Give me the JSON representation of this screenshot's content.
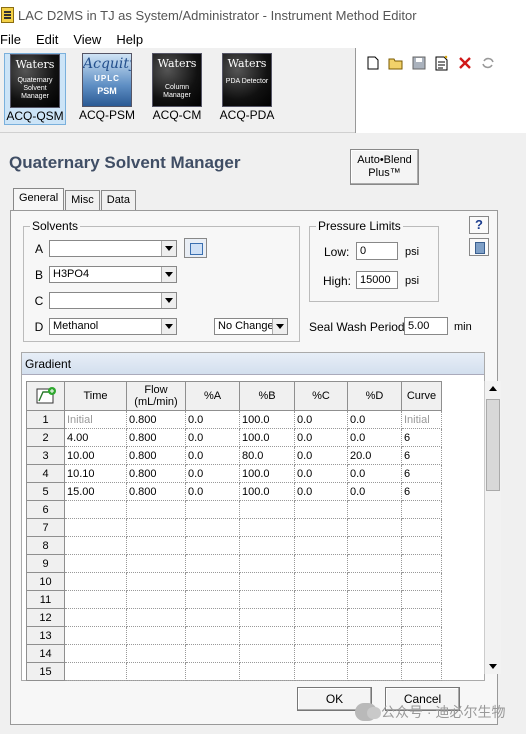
{
  "window": {
    "title": "LAC D2MS in TJ as System/Administrator - Instrument Method Editor"
  },
  "menu": {
    "items": [
      "File",
      "Edit",
      "View",
      "Help"
    ]
  },
  "modules": [
    {
      "label": "ACQ-QSM",
      "brand": "Waters",
      "sub": "Quaternary Solvent Manager",
      "selected": true
    },
    {
      "label": "ACQ-PSM",
      "brand": "Acquity",
      "sub": "UPLC",
      "extra": "PSM",
      "selected": false
    },
    {
      "label": "ACQ-CM",
      "brand": "Waters",
      "sub": "Column Manager",
      "selected": false
    },
    {
      "label": "ACQ-PDA",
      "brand": "Waters",
      "sub": "PDA Detector",
      "selected": false
    }
  ],
  "panel": {
    "title": "Quaternary Solvent Manager",
    "autoblend_label": "Auto•Blend Plus™"
  },
  "tabs": [
    "General",
    "Misc",
    "Data"
  ],
  "solvents": {
    "legend": "Solvents",
    "rows": [
      {
        "letter": "A",
        "value": ""
      },
      {
        "letter": "B",
        "value": "H3PO4"
      },
      {
        "letter": "C",
        "value": ""
      },
      {
        "letter": "D",
        "value": "Methanol"
      }
    ],
    "d_option": "No Change"
  },
  "pressure": {
    "legend": "Pressure Limits",
    "low_label": "Low:",
    "low_value": "0",
    "high_label": "High:",
    "high_value": "15000",
    "unit": "psi"
  },
  "seal_wash": {
    "label": "Seal Wash Period:",
    "value": "5.00",
    "unit": "min"
  },
  "gradient": {
    "title": "Gradient",
    "columns": [
      "Time",
      "Flow (mL/min)",
      "%A",
      "%B",
      "%C",
      "%D",
      "Curve"
    ],
    "rows": [
      {
        "n": "1",
        "time": "Initial",
        "flow": "0.800",
        "a": "0.0",
        "b": "100.0",
        "c": "0.0",
        "d": "0.0",
        "curve": "Initial"
      },
      {
        "n": "2",
        "time": "4.00",
        "flow": "0.800",
        "a": "0.0",
        "b": "100.0",
        "c": "0.0",
        "d": "0.0",
        "curve": "6"
      },
      {
        "n": "3",
        "time": "10.00",
        "flow": "0.800",
        "a": "0.0",
        "b": "80.0",
        "c": "0.0",
        "d": "20.0",
        "curve": "6"
      },
      {
        "n": "4",
        "time": "10.10",
        "flow": "0.800",
        "a": "0.0",
        "b": "100.0",
        "c": "0.0",
        "d": "0.0",
        "curve": "6"
      },
      {
        "n": "5",
        "time": "15.00",
        "flow": "0.800",
        "a": "0.0",
        "b": "100.0",
        "c": "0.0",
        "d": "0.0",
        "curve": "6"
      }
    ],
    "empty_rows": [
      "6",
      "7",
      "8",
      "9",
      "10",
      "11",
      "12",
      "13",
      "14",
      "15"
    ]
  },
  "buttons": {
    "ok": "OK",
    "cancel": "Cancel"
  },
  "watermark": "公众号 · 迪必尔生物"
}
